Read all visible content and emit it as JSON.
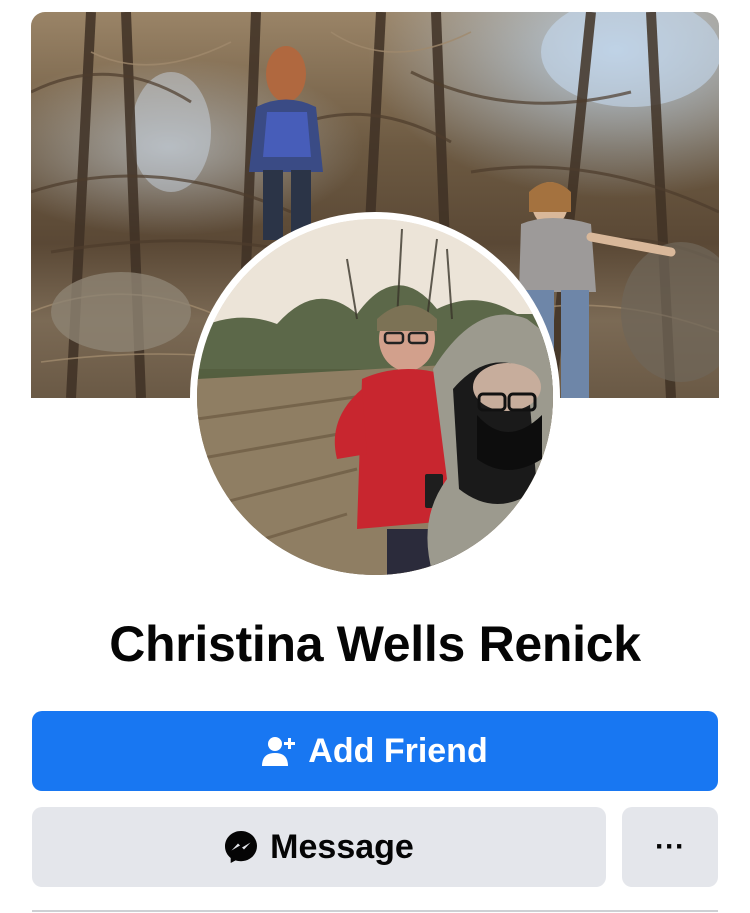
{
  "theme": {
    "accent": "#1877f2",
    "button_secondary": "#e4e6eb"
  },
  "profile": {
    "name": "Christina Wells Renick"
  },
  "actions": {
    "add_friend_label": "Add Friend",
    "add_friend_icon": "add-user-icon",
    "message_label": "Message",
    "message_icon": "messenger-icon",
    "more_label": "···"
  }
}
